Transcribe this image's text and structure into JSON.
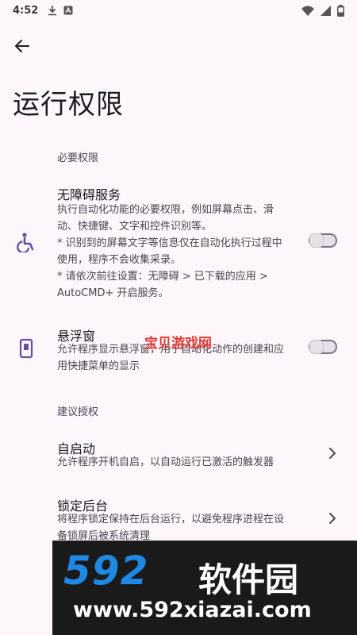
{
  "status_bar": {
    "time": "4:52"
  },
  "page": {
    "title": "运行权限"
  },
  "sections": {
    "required": {
      "header": "必要权限"
    },
    "suggested": {
      "header": "建议授权"
    }
  },
  "accessibility": {
    "title": "无障碍服务",
    "summary_lines": [
      "执行自动化功能的必要权限，例如屏幕点击、滑",
      "动、快捷键、文字和控件识别等。",
      "* 识别到的屏幕文字等信息仅在自动化执行过程中",
      "使用，程序不会收集采录。",
      "* 请依次前往设置：无障碍 > 已下载的应用 >",
      "AutoCMD+ 开启服务。"
    ],
    "enabled": false
  },
  "floating_window": {
    "title": "悬浮窗",
    "summary_lines": [
      "允许程序显示悬浮窗，用于自动化动作的创建和应",
      "用快捷菜单的显示"
    ],
    "enabled": false
  },
  "autostart": {
    "title": "自启动",
    "summary": "允许程序开机自启，以自动运行已激活的触发器"
  },
  "lock_background": {
    "title": "锁定后台",
    "summary_lines": [
      "将程序锁定保持在后台运行，以避免程序进程在设",
      "备锁屏后被系统清理"
    ]
  },
  "watermarks": {
    "overlay_text": "宝贝游戏网",
    "footer_logo": "592",
    "footer_cn": "软件园",
    "footer_url": "www.592xiazai.com"
  },
  "colors": {
    "background": "#fdf7fc",
    "icon_accent": "#6750a4",
    "footer_blue": "#1e88e5"
  }
}
